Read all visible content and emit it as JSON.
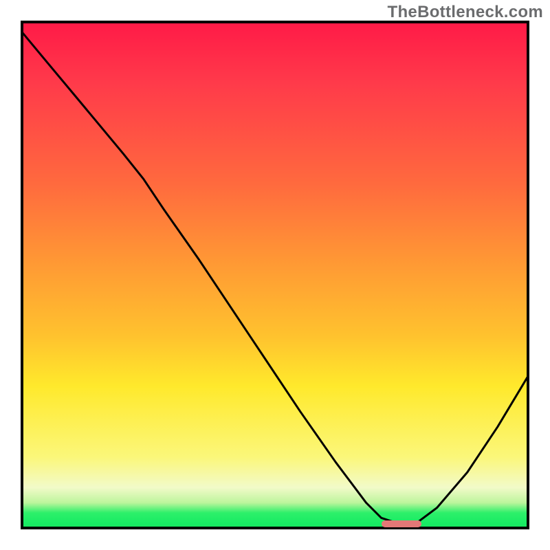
{
  "watermark": "TheBottleneck.com",
  "chart_data": {
    "type": "line",
    "title": "",
    "xlabel": "",
    "ylabel": "",
    "xlim": [
      0,
      100
    ],
    "ylim": [
      0,
      100
    ],
    "grid": false,
    "legend": false,
    "series": [
      {
        "name": "bottleneck-curve",
        "x": [
          0,
          5,
          10,
          15,
          20,
          24,
          28,
          35,
          45,
          55,
          62,
          68,
          71,
          74,
          78,
          82,
          88,
          94,
          100
        ],
        "y": [
          98,
          92,
          86,
          80,
          74,
          69,
          63,
          53,
          38,
          23,
          13,
          5,
          2,
          1,
          1,
          4,
          11,
          20,
          30
        ]
      }
    ],
    "marker": {
      "x_start": 71,
      "x_end": 79,
      "y": 0.8,
      "color": "#e37877"
    },
    "background_gradient": {
      "direction": "vertical",
      "stops": [
        {
          "pos": 0.0,
          "color": "#ff1a47"
        },
        {
          "pos": 0.32,
          "color": "#ff6a3e"
        },
        {
          "pos": 0.62,
          "color": "#ffc22e"
        },
        {
          "pos": 0.86,
          "color": "#fbf77a"
        },
        {
          "pos": 0.95,
          "color": "#bdf59c"
        },
        {
          "pos": 0.99,
          "color": "#19eb64"
        }
      ]
    }
  }
}
